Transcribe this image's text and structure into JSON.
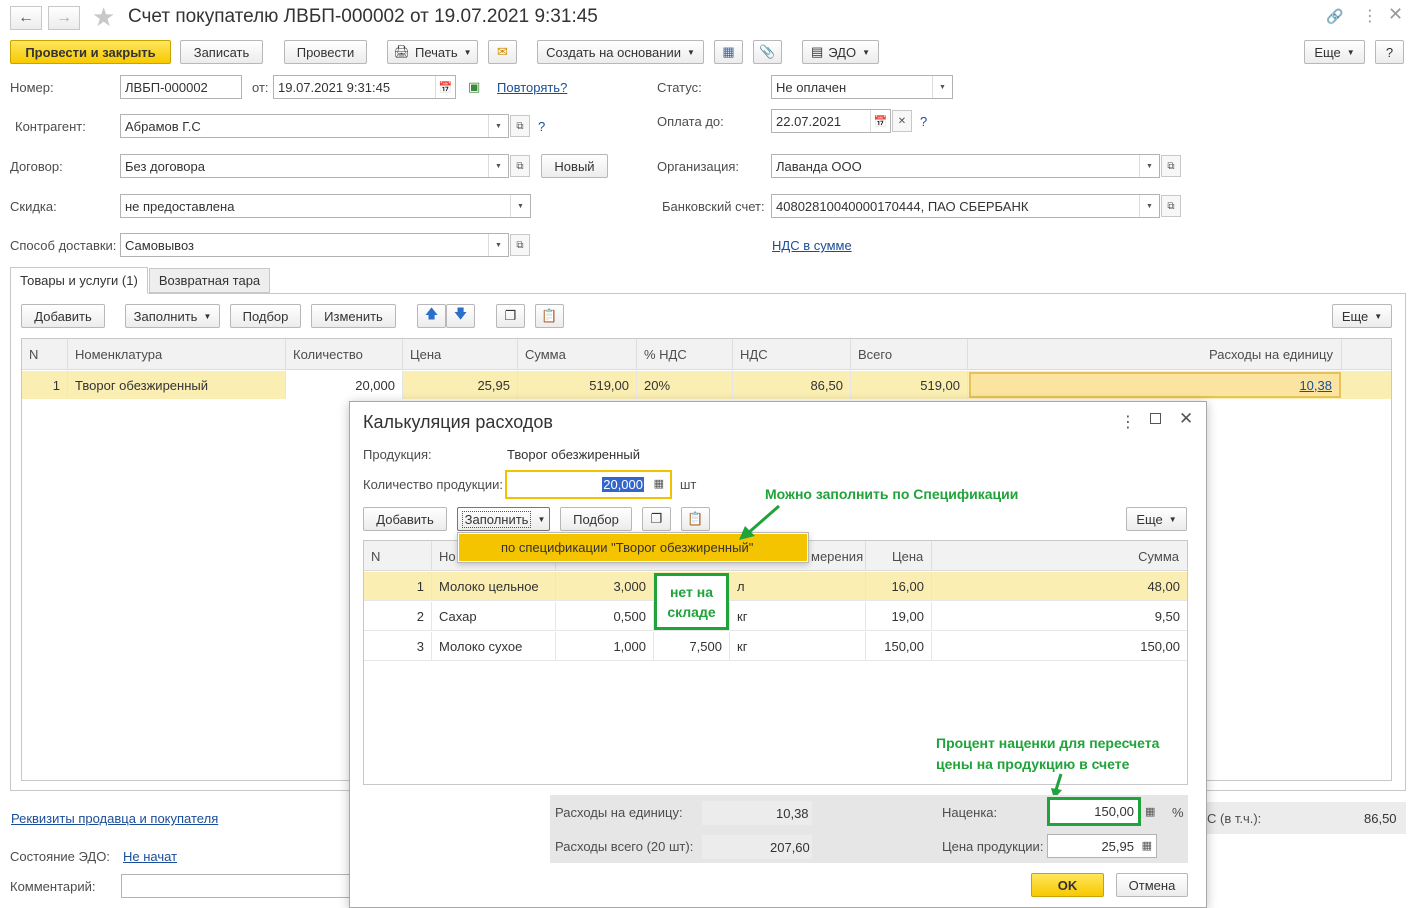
{
  "window": {
    "title": "Счет покупателю ЛВБП-000002 от 19.07.2021 9:31:45"
  },
  "toolbar": {
    "post_close": "Провести и закрыть",
    "save": "Записать",
    "post": "Провести",
    "print": "Печать",
    "create_based": "Создать на основании",
    "edo": "ЭДО",
    "more": "Еще",
    "help": "?"
  },
  "form": {
    "number_label": "Номер:",
    "number_value": "ЛВБП-000002",
    "from_label": "от:",
    "date_value": "19.07.2021  9:31:45",
    "repeat_link": "Повторять?",
    "status_label": "Статус:",
    "status_value": "Не оплачен",
    "contractor_label": "Контрагент:",
    "contractor_value": "Абрамов Г.С",
    "pay_until_label": "Оплата до:",
    "pay_until_value": "22.07.2021",
    "contract_label": "Договор:",
    "contract_value": "Без договора",
    "new_button": "Новый",
    "org_label": "Организация:",
    "org_value": "Лаванда ООО",
    "discount_label": "Скидка:",
    "discount_value": "не предоставлена",
    "bank_label": "Банковский счет:",
    "bank_value": "40802810040000170444, ПАО СБЕРБАНК",
    "delivery_label": "Способ доставки:",
    "delivery_value": "Самовывоз",
    "vat_link": "НДС в сумме",
    "question": "?"
  },
  "tabs": [
    {
      "label": "Товары и услуги (1)"
    },
    {
      "label": "Возвратная тара"
    }
  ],
  "table_toolbar": {
    "add": "Добавить",
    "fill": "Заполнить",
    "pick": "Подбор",
    "change": "Изменить",
    "more": "Еще"
  },
  "goods_table": {
    "headers": [
      "N",
      "Номенклатура",
      "Количество",
      "Цена",
      "Сумма",
      "% НДС",
      "НДС",
      "Всего",
      "Расходы на единицу"
    ],
    "rows": [
      {
        "n": "1",
        "name": "Творог обезжиренный",
        "qty": "20,000",
        "price": "25,95",
        "sum": "519,00",
        "vat_rate": "20%",
        "vat": "86,50",
        "total": "519,00",
        "cost": "10,38"
      }
    ]
  },
  "footer": {
    "requisites_link": "Реквизиты продавца и покупателя",
    "edo_state_label": "Состояние ЭДО:",
    "edo_state_link": "Не начат",
    "comment_label": "Комментарий:",
    "vat_total_label": "С (в т.ч.):",
    "vat_total_value": "86,50"
  },
  "dialog": {
    "title": "Калькуляция расходов",
    "product_label": "Продукция:",
    "product_value": "Творог обезжиренный",
    "qty_label": "Количество продукции:",
    "qty_value": "20,000",
    "unit": "шт",
    "add": "Добавить",
    "fill": "Заполнить",
    "pick": "Подбор",
    "more": "Еще",
    "dropdown_item": "по спецификации \"Творог обезжиренный\"",
    "headers": {
      "n": "N",
      "name": "Но",
      "unit": "мерения",
      "price": "Цена",
      "sum": "Сумма"
    },
    "rows": [
      {
        "n": "1",
        "name": "Молоко цельное",
        "qty": "3,000",
        "stock": "",
        "unit": "л",
        "price": "16,00",
        "sum": "48,00"
      },
      {
        "n": "2",
        "name": "Сахар",
        "qty": "0,500",
        "stock": "",
        "unit": "кг",
        "price": "19,00",
        "sum": "9,50"
      },
      {
        "n": "3",
        "name": "Молоко сухое",
        "qty": "1,000",
        "stock": "7,500",
        "unit": "кг",
        "price": "150,00",
        "sum": "150,00"
      }
    ],
    "cost_unit_label": "Расходы на единицу:",
    "cost_unit_value": "10,38",
    "cost_total_label": "Расходы всего (20 шт):",
    "cost_total_value": "207,60",
    "markup_label": "Наценка:",
    "markup_value": "150,00",
    "percent": "%",
    "price_label": "Цена продукции:",
    "price_value": "25,95",
    "ok": "OK",
    "cancel": "Отмена"
  },
  "annotations": {
    "fill_spec": "Можно заполнить по Спецификации",
    "not_in_stock_1": "нет на",
    "not_in_stock_2": "складе",
    "markup_note_1": "Процент наценки для пересчета",
    "markup_note_2": "цены на продукцию в счете"
  },
  "colors": {
    "accent_yellow": "#f7c900",
    "selected_row": "#fbeeb3",
    "annotation_green": "#1fa33a",
    "link_blue": "#1a4d99"
  }
}
